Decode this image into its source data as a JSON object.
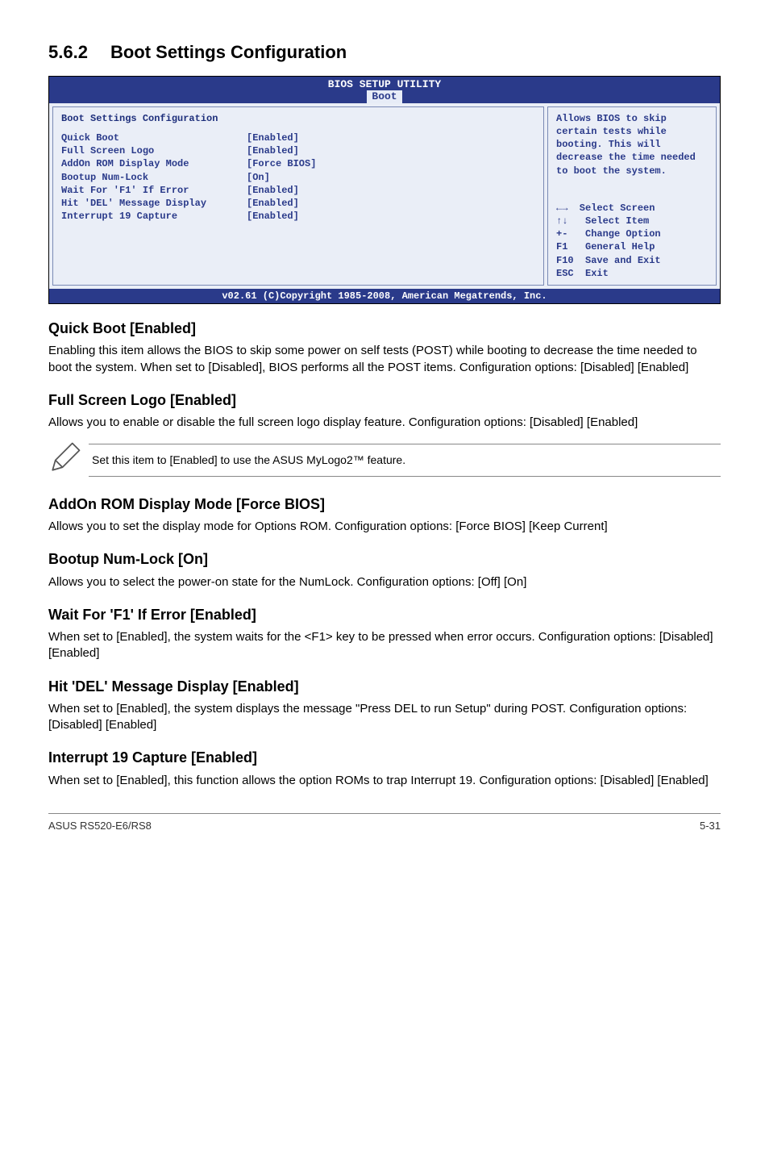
{
  "section": {
    "number": "5.6.2",
    "title": "Boot Settings Configuration"
  },
  "bios": {
    "header_top": "BIOS SETUP UTILITY",
    "tab": "Boot",
    "panel_title": "Boot Settings Configuration",
    "rows": [
      {
        "k": "Quick Boot",
        "v": "[Enabled]"
      },
      {
        "k": "Full Screen Logo",
        "v": "[Enabled]"
      },
      {
        "k": "AddOn ROM Display Mode",
        "v": "[Force BIOS]"
      },
      {
        "k": "Bootup Num-Lock",
        "v": "[On]"
      },
      {
        "k": "Wait For 'F1' If Error",
        "v": "[Enabled]"
      },
      {
        "k": "Hit 'DEL' Message Display",
        "v": "[Enabled]"
      },
      {
        "k": "Interrupt 19 Capture",
        "v": "[Enabled]"
      }
    ],
    "help": "Allows BIOS to skip certain tests while booting. This will decrease the time needed to boot the system.",
    "nav": [
      "←→  Select Screen",
      "↑↓   Select Item",
      "+-   Change Option",
      "F1   General Help",
      "F10  Save and Exit",
      "ESC  Exit"
    ],
    "footer": "v02.61 (C)Copyright 1985-2008, American Megatrends, Inc."
  },
  "items": {
    "quick_boot": {
      "h": "Quick Boot [Enabled]",
      "p": "Enabling this item allows the BIOS to skip some power on self tests (POST) while booting to decrease the time needed to boot the system. When set to [Disabled], BIOS performs all the POST items. Configuration options: [Disabled] [Enabled]"
    },
    "full_screen_logo": {
      "h": "Full Screen Logo [Enabled]",
      "p": "Allows you to enable or disable the full screen logo display feature. Configuration options: [Disabled] [Enabled]"
    },
    "note": "Set this item to [Enabled] to use the ASUS MyLogo2™ feature.",
    "addon_rom": {
      "h": "AddOn ROM Display Mode [Force BIOS]",
      "p": "Allows you to set the display mode for Options ROM. Configuration options: [Force BIOS] [Keep Current]"
    },
    "numlock": {
      "h": "Bootup Num-Lock [On]",
      "p": "Allows you to select the power-on state for the NumLock. Configuration options: [Off] [On]"
    },
    "wait_f1": {
      "h": "Wait For 'F1' If Error [Enabled]",
      "p": "When set to [Enabled], the system waits for the <F1> key to be pressed when error occurs. Configuration options: [Disabled] [Enabled]"
    },
    "hit_del": {
      "h": "Hit 'DEL' Message Display [Enabled]",
      "p": "When set to [Enabled], the system displays the message \"Press DEL to run Setup\" during POST. Configuration options: [Disabled] [Enabled]"
    },
    "int19": {
      "h": "Interrupt 19 Capture [Enabled]",
      "p": "When set to [Enabled], this function allows the option ROMs to trap Interrupt 19. Configuration options: [Disabled] [Enabled]"
    }
  },
  "footer": {
    "left": "ASUS RS520-E6/RS8",
    "right": "5-31"
  }
}
